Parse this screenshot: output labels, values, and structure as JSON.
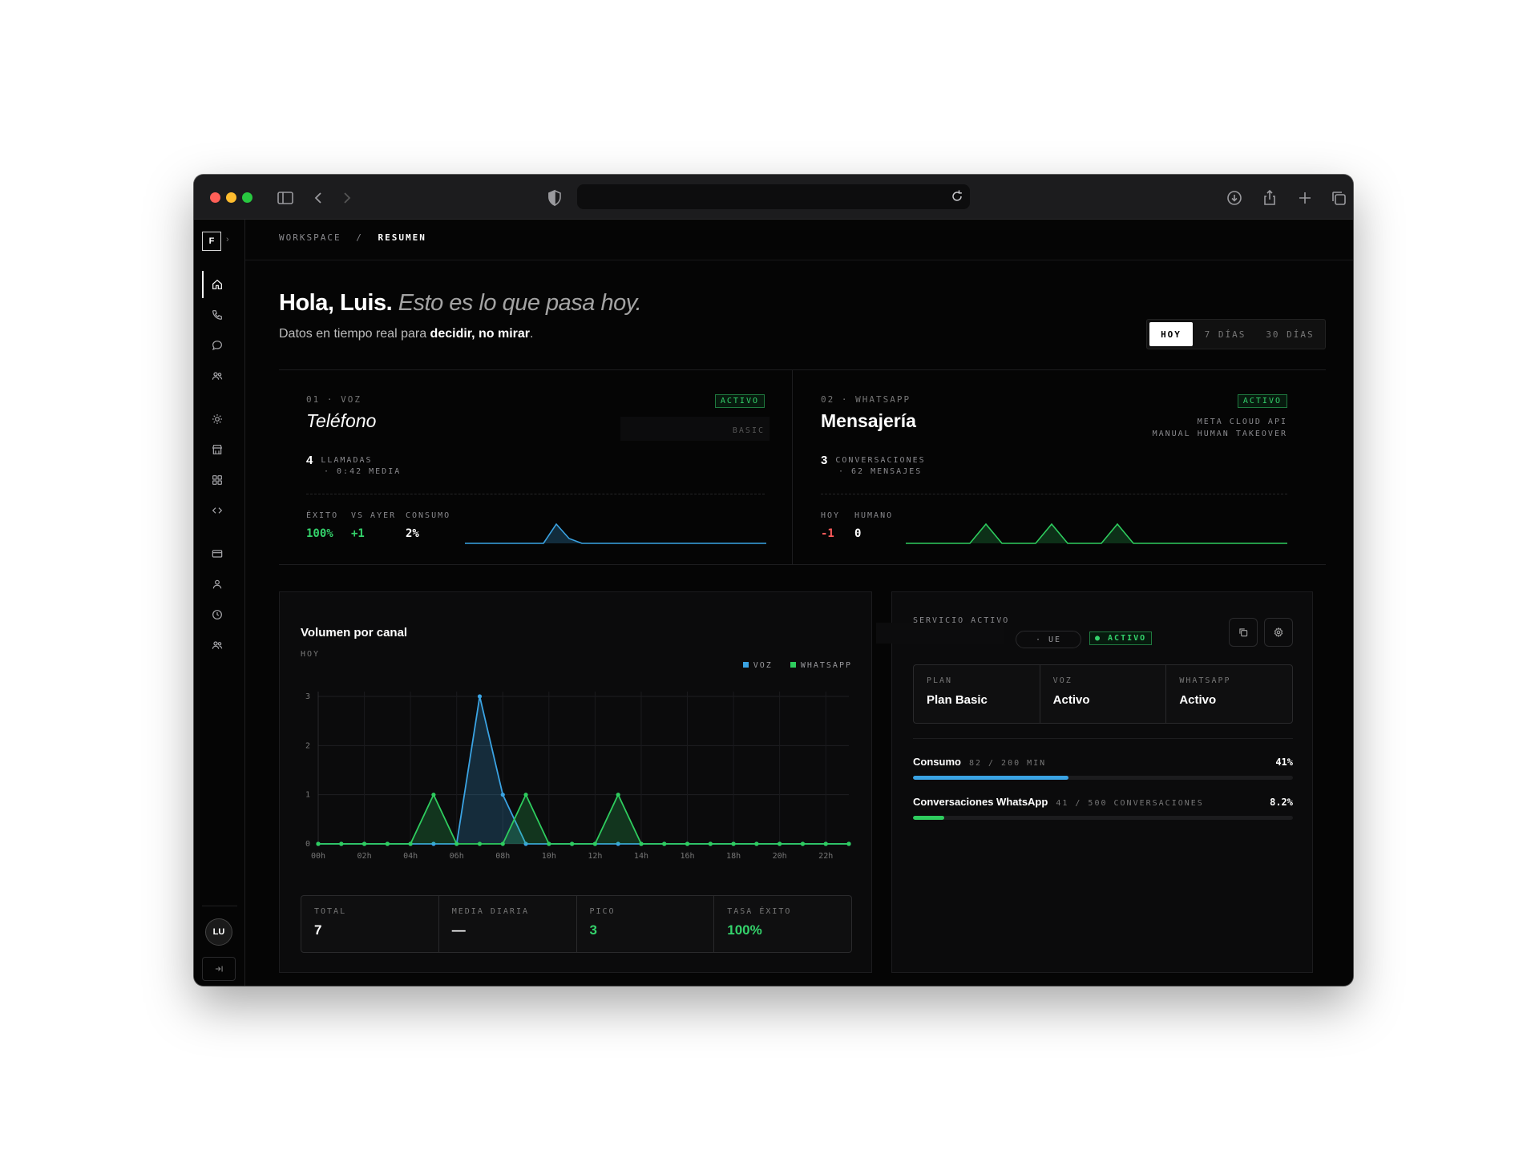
{
  "browser": {
    "traffic_colors": [
      "#ff5f57",
      "#febc2e",
      "#28c840"
    ]
  },
  "sidebar": {
    "brand": "F",
    "brand_chevron": "›",
    "avatar": "LU",
    "items": [
      "home-icon",
      "phone-icon",
      "chat-icon",
      "users-icon",
      "sun-icon",
      "store-icon",
      "grid-icon",
      "code-icon",
      "card-icon",
      "user-icon",
      "clock-icon",
      "team-icon"
    ]
  },
  "breadcrumb": {
    "root": "WORKSPACE",
    "sep": "/",
    "current": "RESUMEN"
  },
  "header": {
    "greeting": "Hola, Luis.",
    "greeting_italic": "Esto es lo que pasa hoy.",
    "subtitle_pre": "Datos en tiempo real para ",
    "subtitle_bold": "decidir, no mirar",
    "subtitle_post": "."
  },
  "range": {
    "options": [
      "HOY",
      "7 DÍAS",
      "30 DÍAS"
    ],
    "selected": "HOY"
  },
  "channels": {
    "voice": {
      "index": "01 · VOZ",
      "title": "Teléfono",
      "badge": "ACTIVO",
      "meta": "BASIC",
      "count": "4",
      "count_unit": "LLAMADAS",
      "count_sub": "· 0:42 MEDIA",
      "stats": [
        {
          "label": "ÉXITO",
          "value": "100%"
        },
        {
          "label": "VS AYER",
          "value": "+1"
        },
        {
          "label": "CONSUMO",
          "value": "2%"
        }
      ],
      "color": "#3aa3e3"
    },
    "whatsapp": {
      "index": "02 · WHATSAPP",
      "title": "Mensajería",
      "badge": "ACTIVO",
      "meta1": "META CLOUD API",
      "meta2": "MANUAL HUMAN TAKEOVER",
      "count": "3",
      "count_unit": "CONVERSACIONES",
      "count_sub": "· 62 MENSAJES",
      "stats": [
        {
          "label": "HOY",
          "value": "-1"
        },
        {
          "label": "HUMANO",
          "value": "0"
        }
      ],
      "color": "#2ecc5e"
    }
  },
  "volume": {
    "title": "Volumen por canal",
    "period": "HOY",
    "legend": [
      "VOZ",
      "WHATSAPP"
    ],
    "stats": [
      {
        "label": "TOTAL",
        "value": "7"
      },
      {
        "label": "MEDIA DIARIA",
        "value": "—"
      },
      {
        "label": "PICO",
        "value": "3"
      },
      {
        "label": "TASA ÉXITO",
        "value": "100%"
      }
    ]
  },
  "chart_data": {
    "type": "area",
    "title": "Volumen por canal",
    "categories": [
      "00h",
      "01h",
      "02h",
      "03h",
      "04h",
      "05h",
      "06h",
      "07h",
      "08h",
      "09h",
      "10h",
      "11h",
      "12h",
      "13h",
      "14h",
      "15h",
      "16h",
      "17h",
      "18h",
      "19h",
      "20h",
      "21h",
      "22h",
      "23h"
    ],
    "tick_labels": [
      "00h",
      "02h",
      "04h",
      "06h",
      "08h",
      "10h",
      "12h",
      "14h",
      "16h",
      "18h",
      "20h",
      "22h"
    ],
    "series": [
      {
        "name": "VOZ",
        "color": "#3aa3e3",
        "values": [
          0,
          0,
          0,
          0,
          0,
          0,
          0,
          3,
          1,
          0,
          0,
          0,
          0,
          0,
          0,
          0,
          0,
          0,
          0,
          0,
          0,
          0,
          0,
          0
        ]
      },
      {
        "name": "WHATSAPP",
        "color": "#2ecc5e",
        "values": [
          0,
          0,
          0,
          0,
          0,
          1,
          0,
          0,
          0,
          1,
          0,
          0,
          0,
          1,
          0,
          0,
          0,
          0,
          0,
          0,
          0,
          0,
          0,
          0
        ]
      }
    ],
    "ylim": [
      0,
      3
    ],
    "yticks": [
      0,
      1,
      2,
      3
    ],
    "grid": true,
    "legend": "top-right"
  },
  "service": {
    "label": "SERVICIO ACTIVO",
    "chip": "· UE",
    "badge": "● ACTIVO",
    "cells": [
      {
        "label": "PLAN",
        "value": "Plan Basic"
      },
      {
        "label": "VOZ",
        "value": "Activo"
      },
      {
        "label": "WHATSAPP",
        "value": "Activo"
      }
    ],
    "usage": [
      {
        "name": "Consumo",
        "detail": "82 / 200 MIN",
        "pct": "41%",
        "fraction": 0.41,
        "color": "#3aa3e3"
      },
      {
        "name": "Conversaciones WhatsApp",
        "detail": "41 / 500 CONVERSACIONES",
        "pct": "8.2%",
        "fraction": 0.082,
        "color": "#2ecc5e"
      }
    ]
  }
}
